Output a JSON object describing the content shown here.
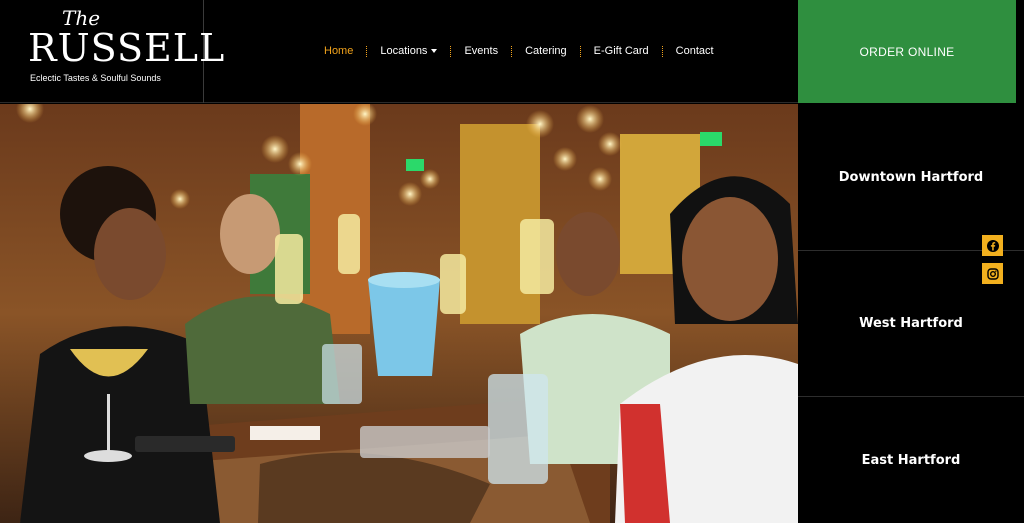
{
  "logo": {
    "the": "The",
    "name": "RUSSELL",
    "tagline": "Eclectic Tastes & Soulful Sounds"
  },
  "nav": [
    {
      "label": "Home",
      "active": true
    },
    {
      "label": "Locations",
      "has_dropdown": true
    },
    {
      "label": "Events"
    },
    {
      "label": "Catering"
    },
    {
      "label": "E-Gift Card"
    },
    {
      "label": "Contact"
    }
  ],
  "order_button": "ORDER ONLINE",
  "locations": [
    "Downtown Hartford",
    "West Hartford",
    "East Hartford"
  ],
  "social": {
    "facebook_icon": "facebook-icon",
    "instagram_icon": "instagram-icon"
  },
  "colors": {
    "accent": "#f2a31b",
    "order_green": "#2f8f3f",
    "social_yellow": "#f2b01e",
    "background": "#000000"
  }
}
